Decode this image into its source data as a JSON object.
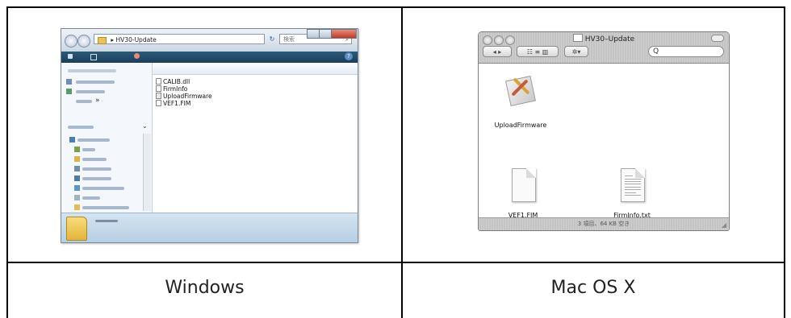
{
  "captions": {
    "windows": "Windows",
    "mac": "Mac OS X"
  },
  "windows_window": {
    "address_path": "HV30-Update",
    "address_separator": "▸",
    "search_placeholder": "検索",
    "files": [
      "CALIB.dll",
      "FirmInfo",
      "UploadFirmware",
      "VEF1.FIM"
    ],
    "icons": {
      "back": "back-arrow-icon",
      "forward": "forward-arrow-icon",
      "refresh": "refresh-icon",
      "search": "magnifier-icon",
      "folder": "folder-icon"
    },
    "toolbar_help": "?"
  },
  "mac_window": {
    "title": "HV30–Update",
    "status_text": "3 項目、64 KB 空き",
    "items": [
      {
        "label": "UploadFirmware",
        "icon": "application-icon"
      },
      {
        "label": "VEF1.FIM",
        "icon": "blank-document-icon"
      },
      {
        "label": "FirmInfo.txt",
        "icon": "text-document-icon"
      }
    ],
    "search_glyph": "Q",
    "nav_label": "◂ ▸",
    "view_label": "☷ ≡ ▥",
    "action_label": "✲▾"
  },
  "colors": {
    "table_border": "#000000",
    "vista_toolbar": "#1f4a66",
    "mac_chrome": "#c8c8c8"
  }
}
